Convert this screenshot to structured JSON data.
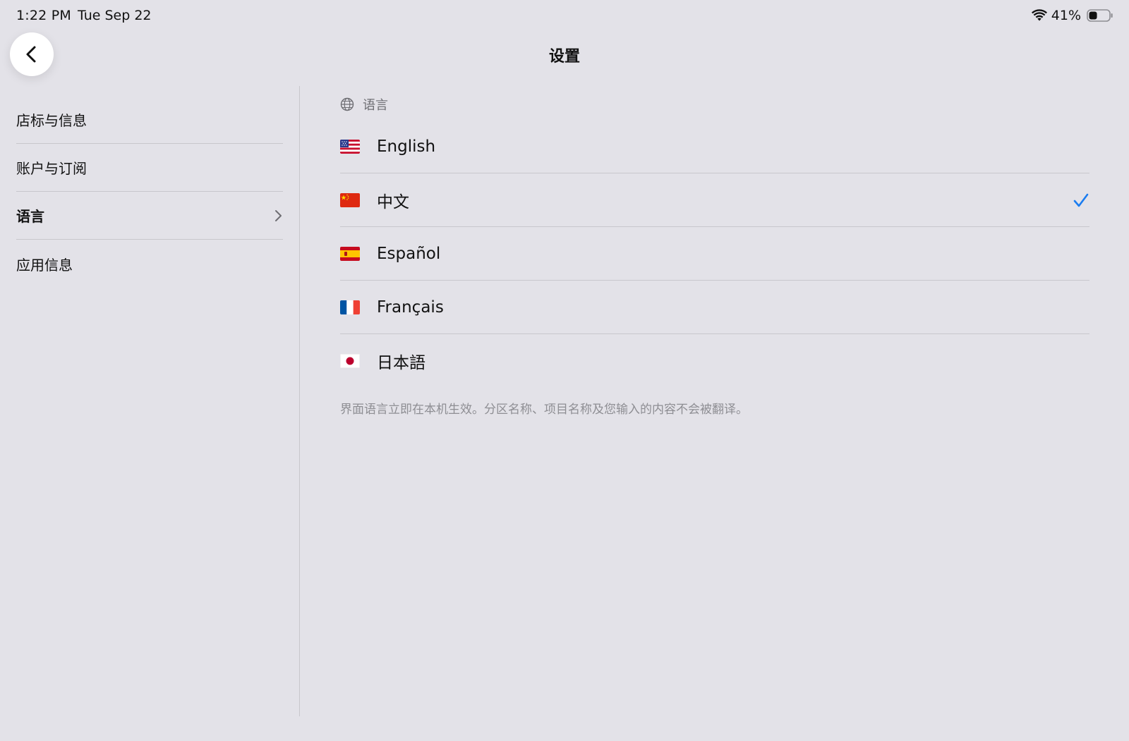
{
  "status_bar": {
    "time": "1:22 PM",
    "date": "Tue Sep 22",
    "battery_percent": "41%",
    "battery_level": 0.41,
    "icons": [
      "wifi-icon",
      "battery-icon"
    ]
  },
  "header": {
    "back_icon": "chevron-left-icon",
    "title": "设置"
  },
  "sidebar": {
    "items": [
      {
        "label": "店标与信息"
      },
      {
        "label": "账户与订阅"
      },
      {
        "label": "语言",
        "selected": true
      },
      {
        "label": "应用信息"
      }
    ]
  },
  "content": {
    "section_icon": "globe-icon",
    "section_title": "语言",
    "languages": [
      {
        "label": "English",
        "flag": "us-flag-icon"
      },
      {
        "label": "中文",
        "flag": "cn-flag-icon",
        "selected": true
      },
      {
        "label": "Español",
        "flag": "es-flag-icon"
      },
      {
        "label": "Français",
        "flag": "fr-flag-icon"
      },
      {
        "label": "日本語",
        "flag": "jp-flag-icon"
      }
    ],
    "footnote": "界面语言立即在本机生效。分区名称、项目名称及您输入的内容不会被翻译。"
  },
  "colors": {
    "background": "#e3e2e8",
    "divider": "#c8c7cc",
    "accent": "#1a7cf0",
    "secondary_text": "#8e8e93"
  }
}
